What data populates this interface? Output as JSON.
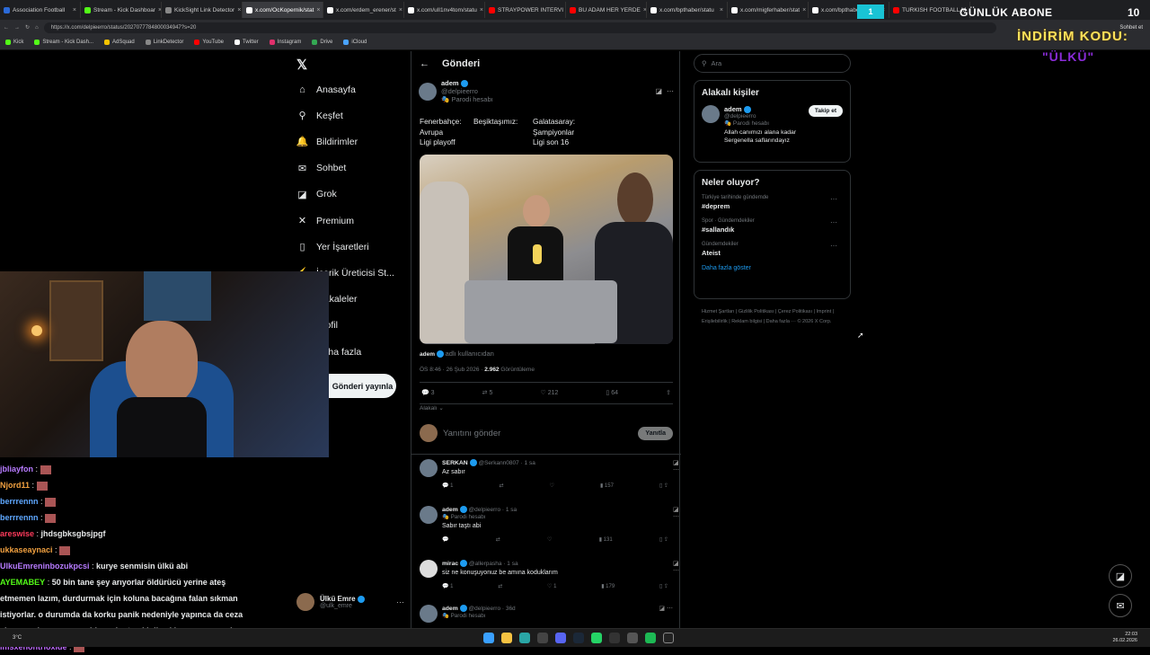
{
  "browser": {
    "tabs": [
      {
        "label": "Association Football",
        "color": "#2b6ad8"
      },
      {
        "label": "Stream - Kick Dashboar",
        "color": "#53fc18"
      },
      {
        "label": "KickSight Link Detector",
        "color": "#888"
      },
      {
        "label": "x.com/OcKopernik/stat",
        "color": "#fff"
      },
      {
        "label": "x.com/erdem_erener/st",
        "color": "#fff"
      },
      {
        "label": "x.com/ulI1nv4tom/statu",
        "color": "#fff"
      },
      {
        "label": "STRAYPOWER INTERVI",
        "color": "#f00"
      },
      {
        "label": "BU ADAM HER YERDE",
        "color": "#f00"
      },
      {
        "label": "x.com/bpthaber/statu",
        "color": "#fff"
      },
      {
        "label": "x.com/migferhaber/stat",
        "color": "#fff"
      },
      {
        "label": "x.com/bpthaber",
        "color": "#fff"
      },
      {
        "label": "TURKISH FOOTBALL M",
        "color": "#f00"
      }
    ],
    "url": "https://x.com/delpieerro/status/2027077784800034947?s=20",
    "bookmarks": [
      {
        "label": "Kick",
        "color": "#53fc18"
      },
      {
        "label": "Stream - Kick Dash...",
        "color": "#53fc18"
      },
      {
        "label": "AdSquad",
        "color": "#f7c400"
      },
      {
        "label": "LinkDetector",
        "color": "#888"
      },
      {
        "label": "YouTube",
        "color": "#f00"
      },
      {
        "label": "Twitter",
        "color": "#fff"
      },
      {
        "label": "Instagram",
        "color": "#e1306c"
      },
      {
        "label": "Drive",
        "color": "#34a853"
      },
      {
        "label": "iCloud",
        "color": "#4aa3ff"
      }
    ],
    "profile_label": "Sohbet et"
  },
  "overlay": {
    "box_label": "1",
    "title": "GÜNLÜK ABONE",
    "count": "10",
    "discount_label": "İNDİRİM KODU:",
    "code": "\"ÜLKÜ\""
  },
  "nav": {
    "items": [
      {
        "label": "Anasayfa",
        "icon": "home-icon",
        "glyph": "⌂"
      },
      {
        "label": "Keşfet",
        "icon": "search-icon",
        "glyph": "⚲"
      },
      {
        "label": "Bildirimler",
        "icon": "bell-icon",
        "glyph": "🔔"
      },
      {
        "label": "Sohbet",
        "icon": "mail-icon",
        "glyph": "✉"
      },
      {
        "label": "Grok",
        "icon": "grok-icon",
        "glyph": "◪"
      },
      {
        "label": "Premium",
        "icon": "x-premium-icon",
        "glyph": "✕"
      },
      {
        "label": "Yer İşaretleri",
        "icon": "bookmark-icon",
        "glyph": "▯"
      },
      {
        "label": "İçerik Üreticisi St...",
        "icon": "creator-icon",
        "glyph": "⚡"
      },
      {
        "label": "Makaleler",
        "icon": "article-icon",
        "glyph": "▤"
      },
      {
        "label": "Profil",
        "icon": "profile-icon",
        "glyph": "☺"
      },
      {
        "label": "Daha fazla",
        "icon": "more-icon",
        "glyph": "⋯"
      }
    ],
    "post_button": "Gönderi yayınla",
    "account_name": "Ülkü Emre",
    "account_handle": "@ulk_emre"
  },
  "post": {
    "header": "Gönderi",
    "author": "adem",
    "handle": "@delpieerro",
    "label": "Parodi hesabı",
    "text_col1": "Fenerbahçe:\nAvrupa\nLigi playoff",
    "text_col2": "Beşiktaşımız:",
    "text_col3": "Galatasaray:\nŞampiyonlar\nLigi son 16",
    "image_caption_user": "adem",
    "image_caption": "adlı kullanıcıdan",
    "time": "ÖS 8:46 · 26 Şub 2026 ·",
    "views": "2.962",
    "views_label": "Görüntüleme",
    "replies": "3",
    "reposts": "5",
    "likes": "212",
    "bookmarks": "64",
    "related": "Alakalı",
    "reply_placeholder": "Yanıtını gönder",
    "reply_button": "Yanıtla"
  },
  "replies": [
    {
      "name": "SERKAN",
      "handle": "@Serkann0807 · 1 sa",
      "parody": "",
      "text": "Az sabır",
      "r": "1",
      "l": "",
      "v": "157"
    },
    {
      "name": "adem",
      "handle": "@delpieerro · 1 sa",
      "parody": "Parodi hesabı",
      "text": "Sabır taştı abi",
      "r": "",
      "l": "",
      "v": "131"
    },
    {
      "name": "mirac",
      "handle": "@allerpasha · 1 sa",
      "parody": "",
      "text": "siz ne konuşuyonuz be amına koduklarım",
      "r": "1",
      "l": "1",
      "v": "179"
    },
    {
      "name": "adem",
      "handle": "@delpieerro · 36d",
      "parody": "Parodi hesabı",
      "text": "",
      "r": "",
      "l": "",
      "v": ""
    }
  ],
  "right": {
    "search_placeholder": "Ara",
    "related_title": "Alakalı kişiler",
    "person_name": "adem",
    "person_handle": "@delpieerro",
    "person_label": "Parodi hesabı",
    "person_bio": "Allah canımızı alana kadar Sergenella saflarındayız",
    "follow_button": "Takip et",
    "trends_title": "Neler oluyor?",
    "trends": [
      {
        "context": "Türkiye tarihinde gündemde",
        "topic": "#deprem"
      },
      {
        "context": "Spor · Gündemdekiler",
        "topic": "#sallandık"
      },
      {
        "context": "Gündemdekiler",
        "topic": "Ateist"
      }
    ],
    "show_more": "Daha fazla göster",
    "footer": "Hizmet Şartları | Gizlilik Politikası | Çerez Politikası | Imprint | Erişilebilirlik | Reklam bilgisi | Daha fazla ··· © 2026 X Corp."
  },
  "chat": [
    {
      "user": "jbliayfon",
      "color": "#b77bff",
      "msg": ""
    },
    {
      "user": "Njord11",
      "color": "#f0a040",
      "msg": ""
    },
    {
      "user": "berrrennn",
      "color": "#5fa8ff",
      "msg": ""
    },
    {
      "user": "berrrennn",
      "color": "#5fa8ff",
      "msg": ""
    },
    {
      "user": "areswise",
      "color": "#ff3b5c",
      "msg": "jhdsgbksgbsjpgf"
    },
    {
      "user": "ukkaseaynaci",
      "color": "#f0a040",
      "msg": ""
    },
    {
      "user": "UlkuEmreninbozukpcsi",
      "color": "#b77bff",
      "msg": "kurye senmisin ülkü abi"
    },
    {
      "user": "AYEMABEY",
      "color": "#53fc18",
      "msg": "50 bin tane şey arıyorlar öldürücü yerine ateş"
    },
    {
      "user": "",
      "color": "#fff",
      "msg": "etmemen lazım, durdurmak için koluna bacağına falan sıkman"
    },
    {
      "user": "",
      "color": "#fff",
      "msg": "istiyorlar. o durumda da korku panik nedeniyle yapınca da ceza"
    },
    {
      "user": "",
      "color": "#fff",
      "msg": "almaman lazım ama mahkemeler temkinli yaklaşıyor o meseleye"
    },
    {
      "user": "imsxenontrioxide",
      "color": "#c06cff",
      "msg": ""
    }
  ],
  "taskbar": {
    "time": "22:03",
    "date": "26.02.2026",
    "weather": "3°C"
  }
}
